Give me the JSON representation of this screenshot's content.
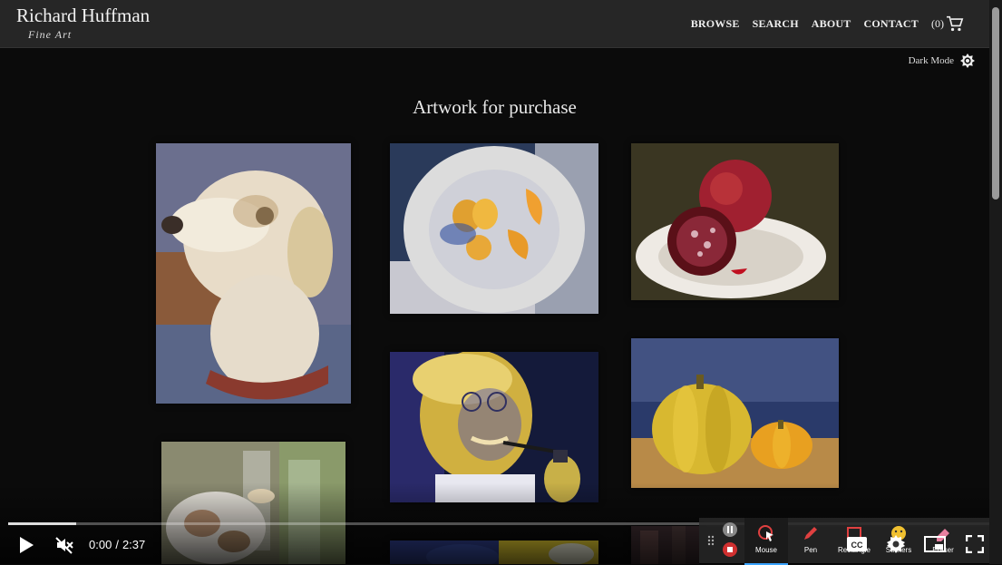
{
  "header": {
    "brand_name": "Richard Huffman",
    "brand_sub": "Fine Art",
    "nav": [
      "BROWSE",
      "SEARCH",
      "ABOUT",
      "CONTACT"
    ],
    "cart_count": "(0)"
  },
  "dark_mode_label": "Dark Mode",
  "page_title": "Artwork for purchase",
  "gallery": [
    {
      "subject": "dog-portrait"
    },
    {
      "subject": "orange-slices-on-plate"
    },
    {
      "subject": "pomegranate-on-plate"
    },
    {
      "subject": "man-with-pipe-portrait"
    },
    {
      "subject": "pumpkins-still-life"
    },
    {
      "subject": "glassware-still-life"
    },
    {
      "subject": "partial-yellow-blue"
    },
    {
      "subject": "partial-dark"
    }
  ],
  "player": {
    "current_time": "0:00",
    "duration": "2:37",
    "progress": 0.069
  },
  "recording_toolbar": {
    "tools": [
      "Mouse",
      "Pen",
      "Rectangle",
      "Stickers",
      "Eraser"
    ],
    "active_tool": "Mouse"
  },
  "colors": {
    "background": "#0b0b0b",
    "header": "#262626",
    "toolbar_accent": "#3aa3ff"
  }
}
